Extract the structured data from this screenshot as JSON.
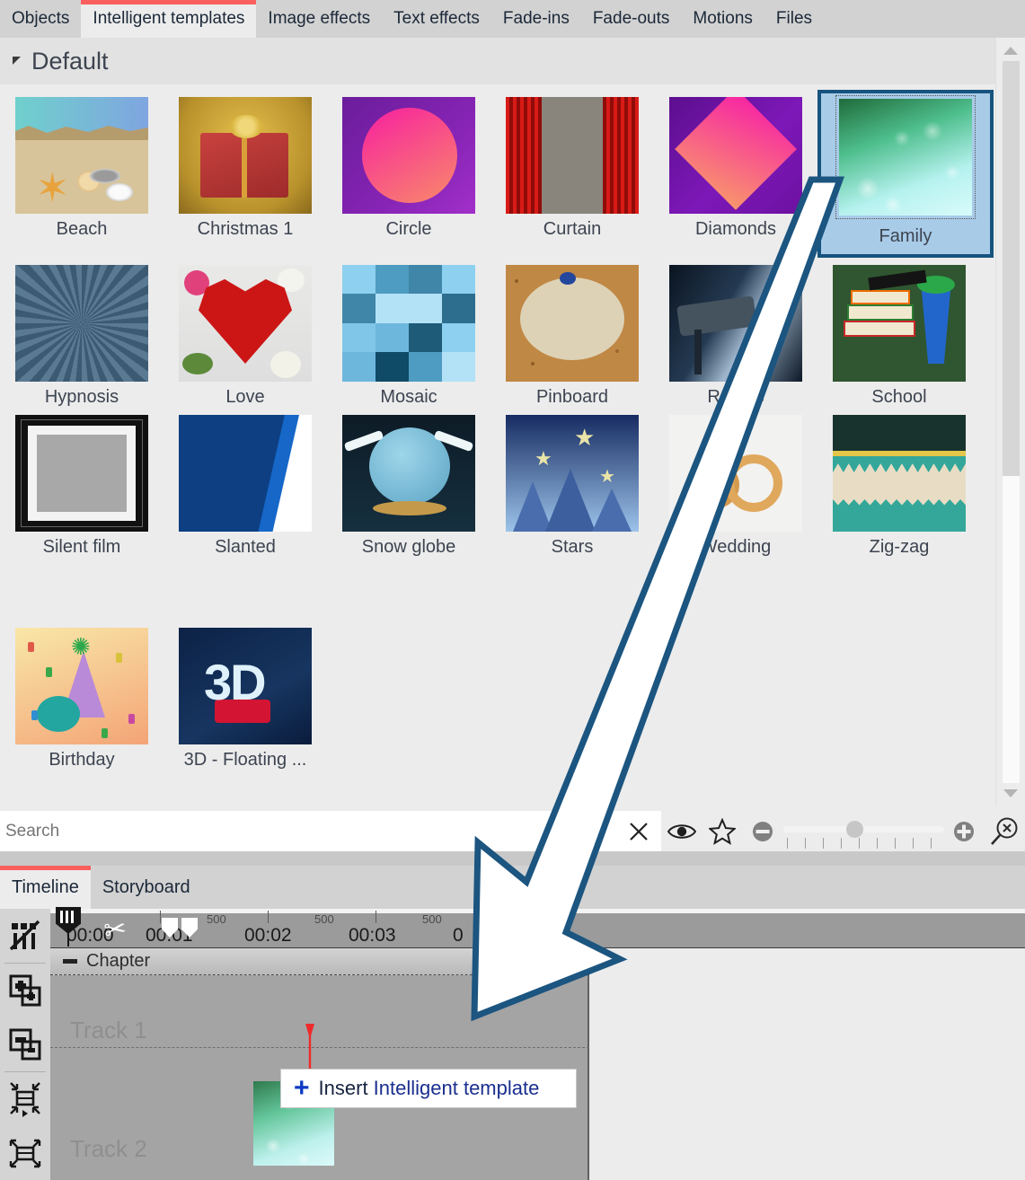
{
  "tabs": [
    {
      "label": "Objects",
      "active": false
    },
    {
      "label": "Intelligent templates",
      "active": true
    },
    {
      "label": "Image effects",
      "active": false
    },
    {
      "label": "Text effects",
      "active": false
    },
    {
      "label": "Fade-ins",
      "active": false
    },
    {
      "label": "Fade-outs",
      "active": false
    },
    {
      "label": "Motions",
      "active": false
    },
    {
      "label": "Files",
      "active": false
    }
  ],
  "group": {
    "title": "Default",
    "caret": "collapse-caret"
  },
  "templates": [
    {
      "name": "Beach"
    },
    {
      "name": "Christmas 1"
    },
    {
      "name": "Circle"
    },
    {
      "name": "Curtain"
    },
    {
      "name": "Diamonds"
    },
    {
      "name": "Family",
      "selected": true
    },
    {
      "name": "Hypnosis"
    },
    {
      "name": "Love"
    },
    {
      "name": "Mosaic"
    },
    {
      "name": "Pinboard"
    },
    {
      "name": "Routes"
    },
    {
      "name": "School"
    },
    {
      "name": "Silent film"
    },
    {
      "name": "Slanted"
    },
    {
      "name": "Snow globe"
    },
    {
      "name": "Stars"
    },
    {
      "name": "Wedding"
    },
    {
      "name": "Zig-zag"
    },
    {
      "name": "Birthday"
    },
    {
      "name": "3D - Floating ..."
    }
  ],
  "search": {
    "value": "",
    "placeholder": "Search",
    "clear_icon": "close-icon",
    "preview_icon": "eye-icon",
    "favorite_icon": "star-icon",
    "zoom_out_icon": "minus-circle-icon",
    "zoom_in_icon": "plus-circle-icon",
    "fit_icon": "magnifier-fit-icon"
  },
  "timeline": {
    "tabs": [
      {
        "label": "Timeline",
        "active": true
      },
      {
        "label": "Storyboard",
        "active": false
      }
    ],
    "toolbar": [
      {
        "icon": "remove-gaps-icon"
      },
      {
        "icon": "add-object-icon"
      },
      {
        "icon": "remove-object-icon"
      },
      {
        "icon": "shrink-track-icon"
      },
      {
        "icon": "expand-track-icon"
      }
    ],
    "ruler": {
      "labels": [
        "00:00",
        "00:01",
        "00:02",
        "00:03",
        "0"
      ],
      "minor_labels": [
        "500",
        "500",
        "500",
        "500"
      ],
      "playhead_icon": "playhead-marker",
      "scissors_icon": "scissors-icon",
      "cut_marker_icon": "cut-marker-icon"
    },
    "chapter": {
      "label": "Chapter",
      "toggle_icon": "minus-toggle-icon"
    },
    "tracks": [
      {
        "label": "Track 1"
      },
      {
        "label": "Track 2"
      }
    ],
    "tooltip": {
      "plus_icon": "plus-icon",
      "prefix": "Insert ",
      "highlight": "Intelligent template"
    }
  },
  "annotation": {
    "arrow": "large-pointer-arrow",
    "arrow_outline_color": "#1b5580",
    "arrow_fill_color": "#ffffff"
  },
  "colors": {
    "accent_red": "#fa5f5f",
    "selection_blue": "#a8cbe8",
    "selection_border": "#17537f",
    "tooltip_blue": "#1b2f8f"
  }
}
